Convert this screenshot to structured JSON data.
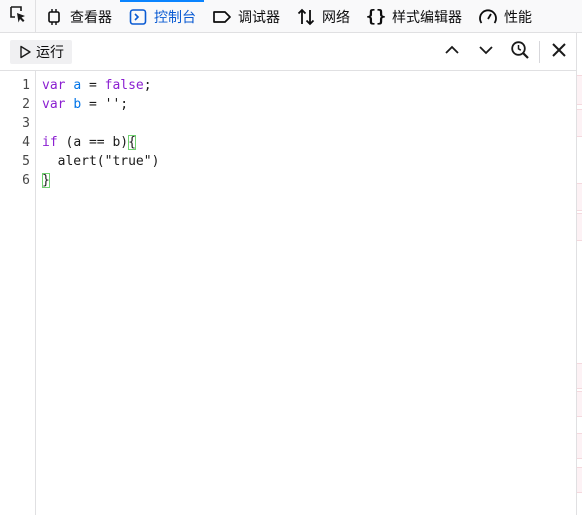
{
  "tabs": [
    {
      "label": "查看器",
      "icon": "inspector-icon",
      "active": false
    },
    {
      "label": "控制台",
      "icon": "console-icon",
      "active": true
    },
    {
      "label": "调试器",
      "icon": "debugger-icon",
      "active": false
    },
    {
      "label": "网络",
      "icon": "network-icon",
      "active": false
    },
    {
      "label": "样式编辑器",
      "icon": "style-editor-icon",
      "active": false
    },
    {
      "label": "性能",
      "icon": "performance-icon",
      "active": false
    }
  ],
  "toolbar": {
    "run_label": "运行"
  },
  "editor": {
    "line_numbers": [
      "1",
      "2",
      "3",
      "4",
      "5",
      "6"
    ]
  },
  "code": {
    "l1": {
      "kw": "var",
      "name": "a",
      "eq": " = ",
      "val": "false",
      "end": ";"
    },
    "l2": {
      "kw": "var",
      "name": "b",
      "eq": " = ",
      "val": "''",
      "end": ";"
    },
    "l4": {
      "kw": "if",
      "open": " (",
      "a": "a",
      "op": " == ",
      "b": "b",
      "close": ")",
      "brace": "{"
    },
    "l5": {
      "indent": "  ",
      "call": "alert(",
      "arg": "\"true\"",
      "end": ")"
    },
    "l6": {
      "brace": "}"
    }
  },
  "colors": {
    "accent": "#0a84ff",
    "active_tab_text": "#0a5bd3",
    "keyword": "#8b1fd1",
    "variable": "#0074e8",
    "brace_match": "#6fd16f"
  }
}
